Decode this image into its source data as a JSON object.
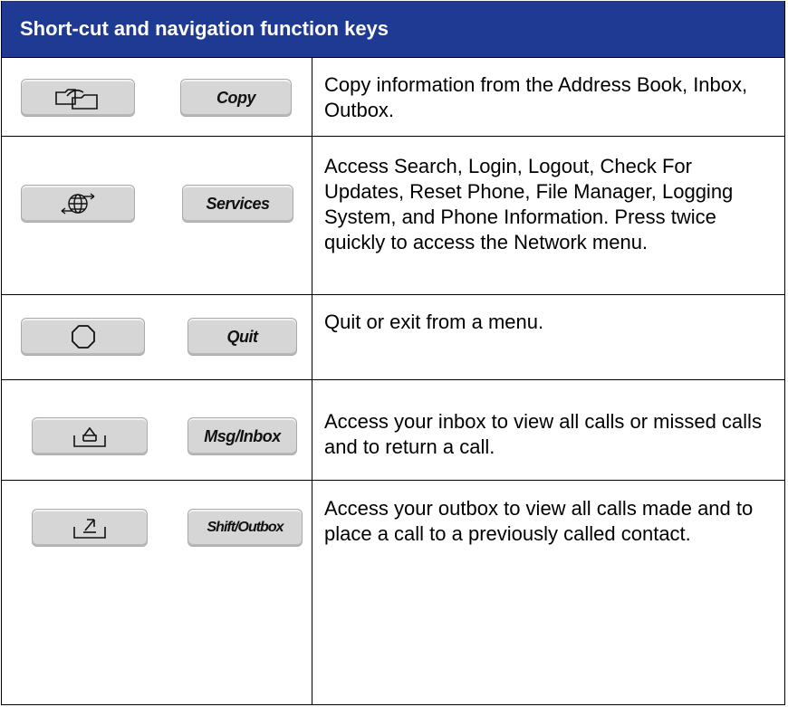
{
  "header": {
    "title": "Short-cut and navigation function keys"
  },
  "rows": [
    {
      "icon": "folders-icon",
      "key_label": "Copy",
      "description": "Copy information from the Address Book, Inbox, Outbox."
    },
    {
      "icon": "globe-arrows-icon",
      "key_label": "Services",
      "description": "Access Search, Login, Logout, Check For Updates, Reset Phone, File Manager, Logging System, and Phone Information. Press twice quickly to access the Network menu."
    },
    {
      "icon": "octagon-icon",
      "key_label": "Quit",
      "description": "Quit or exit from a menu."
    },
    {
      "icon": "inbox-tray-icon",
      "key_label": "Msg/Inbox",
      "description": "Access your inbox to view all calls or missed calls and to return a call."
    },
    {
      "icon": "outbox-tray-icon",
      "key_label": "Shift/Outbox",
      "description": "Access your outbox to view all calls made and to place a call to a previously called contact."
    }
  ],
  "colors": {
    "header_bg": "#1f3a93",
    "header_text": "#ffffff",
    "key_bg": "#d6d6d6"
  }
}
